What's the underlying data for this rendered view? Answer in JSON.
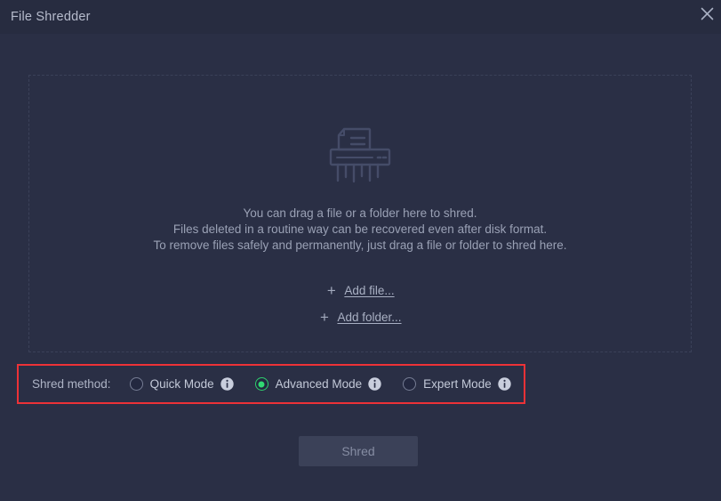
{
  "window": {
    "title": "File Shredder",
    "close_label": "×",
    "bg_color": "#2a2f45",
    "titlebar_color": "#272c40"
  },
  "dropzone": {
    "icon_name": "shredder-icon",
    "description_lines": [
      "You can drag a file or a folder here to shred.",
      "Files deleted in a routine way can be recovered even after disk format.",
      "To remove files safely and permanently, just drag a file or folder to shred here."
    ],
    "actions": [
      {
        "icon": "plus-icon",
        "plus": "+",
        "label": "Add file..."
      },
      {
        "icon": "plus-icon",
        "plus": "+",
        "label": "Add folder..."
      }
    ]
  },
  "shred_method": {
    "label": "Shred method:",
    "highlight_color": "#ed3237",
    "selected": "Advanced Mode",
    "options": [
      {
        "label": "Quick Mode",
        "selected": false,
        "info": "i"
      },
      {
        "label": "Advanced Mode",
        "selected": true,
        "info": "i"
      },
      {
        "label": "Expert Mode",
        "selected": false,
        "info": "i"
      }
    ]
  },
  "footer": {
    "shred_label": "Shred",
    "shred_enabled": false
  }
}
